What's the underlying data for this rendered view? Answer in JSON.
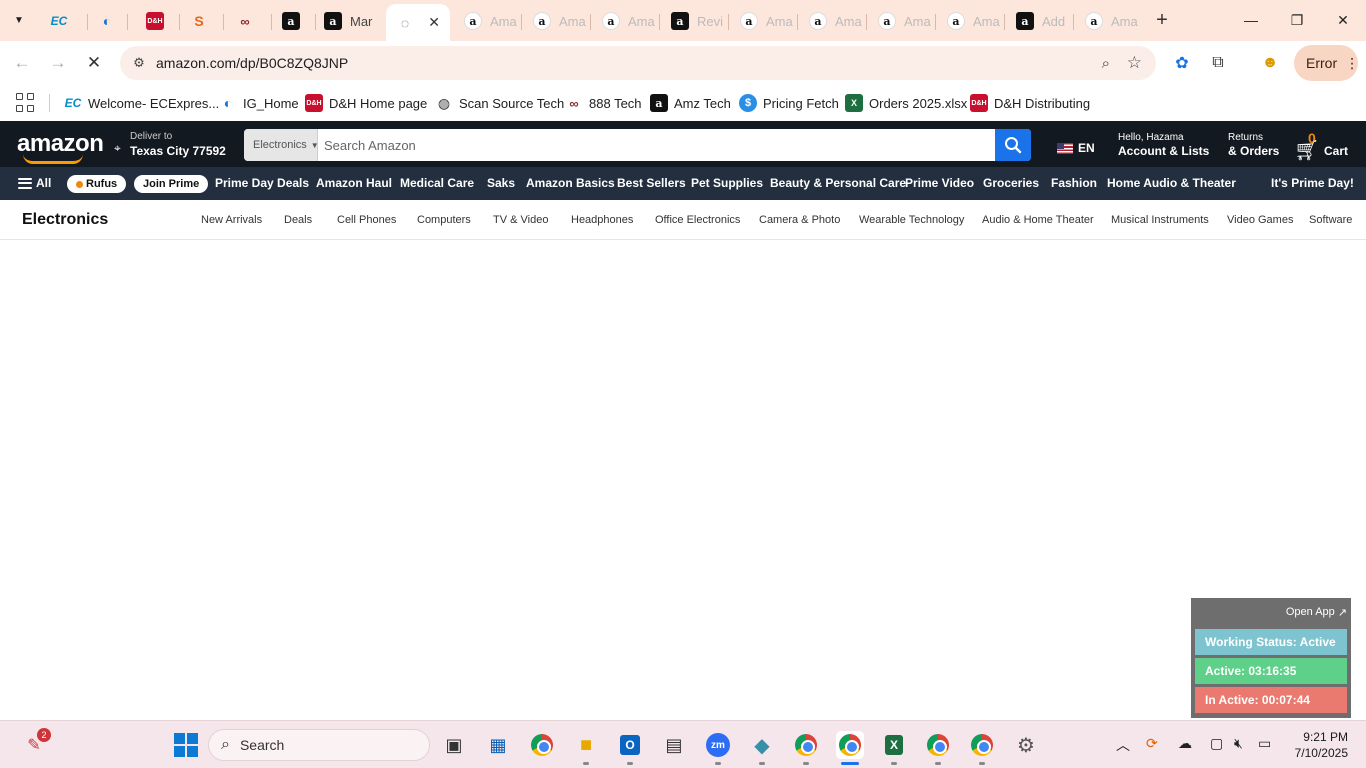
{
  "browser": {
    "tabs": [
      {
        "label": "",
        "icon": "ec-expressway-icon"
      },
      {
        "label": "",
        "icon": "ig-icon"
      },
      {
        "label": "",
        "icon": "dh-icon"
      },
      {
        "label": "",
        "icon": "scansource-icon"
      },
      {
        "label": "",
        "icon": "888-icon"
      },
      {
        "label": "",
        "icon": "amazon-icon"
      },
      {
        "label": "Mar",
        "icon": "amazon-icon"
      },
      {
        "label": "",
        "icon": "loading-icon",
        "active": true
      },
      {
        "label": "Ama",
        "icon": "amazon-icon"
      },
      {
        "label": "Ama",
        "icon": "amazon-icon"
      },
      {
        "label": "Ama",
        "icon": "amazon-icon"
      },
      {
        "label": "Revi",
        "icon": "amazon-icon"
      },
      {
        "label": "Ama",
        "icon": "amazon-icon"
      },
      {
        "label": "Ama",
        "icon": "amazon-icon"
      },
      {
        "label": "Ama",
        "icon": "amazon-icon"
      },
      {
        "label": "Ama",
        "icon": "amazon-icon"
      },
      {
        "label": "Add",
        "icon": "amazon-icon"
      },
      {
        "label": "Ama",
        "icon": "amazon-icon"
      }
    ],
    "url": "amazon.com/dp/B0C8ZQ8JNP",
    "error_label": "Error",
    "bookmarks": [
      {
        "label": "Welcome- ECExpres...",
        "icon": "ec-expressway-icon"
      },
      {
        "label": "IG_Home",
        "icon": "ig-icon"
      },
      {
        "label": "D&H Home page",
        "icon": "dh-icon"
      },
      {
        "label": "Scan Source Tech",
        "icon": "scansource-icon"
      },
      {
        "label": "888 Tech",
        "icon": "888-icon"
      },
      {
        "label": "Amz Tech",
        "icon": "amazon-icon"
      },
      {
        "label": "Pricing Fetch",
        "icon": "pricing-icon"
      },
      {
        "label": "Orders 2025.xlsx",
        "icon": "excel-icon"
      },
      {
        "label": "D&H Distributing",
        "icon": "dh-icon"
      }
    ]
  },
  "amazon": {
    "logo": "amazon",
    "deliver_to": "Deliver to",
    "location": "Texas City 77592",
    "search_category": "Electronics",
    "search_placeholder": "Search Amazon",
    "language": "EN",
    "account_greeting": "Hello, Hazama",
    "account_label": "Account & Lists",
    "returns_line1": "Returns",
    "returns_line2": "& Orders",
    "cart_count": "0",
    "cart_label": "Cart",
    "subnav": {
      "all": "All",
      "rufus": "Rufus",
      "join_prime": "Join Prime",
      "items": [
        "Prime Day Deals",
        "Amazon Haul",
        "Medical Care",
        "Saks",
        "Amazon Basics",
        "Best Sellers",
        "Pet Supplies",
        "Beauty & Personal Care",
        "Prime Video",
        "Groceries",
        "Fashion",
        "Home Audio & Theater"
      ],
      "promo": "It's Prime Day!"
    },
    "category": {
      "title": "Electronics",
      "items": [
        "New Arrivals",
        "Deals",
        "Cell Phones",
        "Computers",
        "TV & Video",
        "Headphones",
        "Office Electronics",
        "Camera & Photo",
        "Wearable Technology",
        "Audio & Home Theater",
        "Musical Instruments",
        "Video Games",
        "Software"
      ]
    }
  },
  "status_widget": {
    "open_app": "Open App",
    "working_status": "Working Status: Active",
    "active": "Active: 03:16:35",
    "inactive": "In Active: 00:07:44",
    "colors": {
      "working": "#7ec4d0",
      "active": "#5fd08a",
      "inactive": "#ea7a70"
    }
  },
  "taskbar": {
    "search_placeholder": "Search",
    "notification_count": "2",
    "time": "9:21 PM",
    "date": "7/10/2025"
  }
}
